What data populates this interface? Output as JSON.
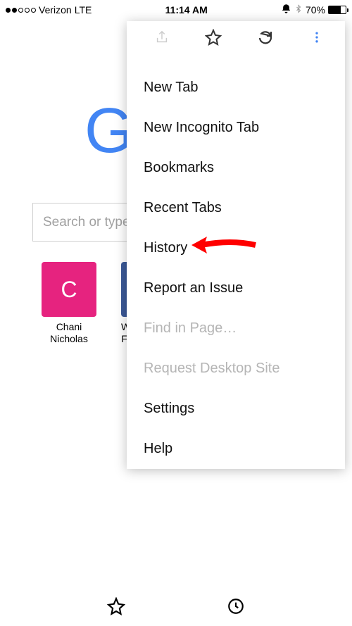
{
  "status": {
    "carrier": "Verizon",
    "network": "LTE",
    "time": "11:14 AM",
    "battery_pct": "70%"
  },
  "search": {
    "placeholder": "Search or type"
  },
  "tiles": [
    {
      "letter": "C",
      "label": "Chani\nNicholas",
      "bg": "#E6237F"
    },
    {
      "letter": "",
      "label": "Wel\nFac",
      "bg": "#3b5998"
    }
  ],
  "menu": {
    "items": [
      {
        "label": "New Tab",
        "disabled": false
      },
      {
        "label": "New Incognito Tab",
        "disabled": false
      },
      {
        "label": "Bookmarks",
        "disabled": false
      },
      {
        "label": "Recent Tabs",
        "disabled": false
      },
      {
        "label": "History",
        "disabled": false
      },
      {
        "label": "Report an Issue",
        "disabled": false
      },
      {
        "label": "Find in Page…",
        "disabled": true
      },
      {
        "label": "Request Desktop Site",
        "disabled": true
      },
      {
        "label": "Settings",
        "disabled": false
      },
      {
        "label": "Help",
        "disabled": false
      }
    ]
  }
}
